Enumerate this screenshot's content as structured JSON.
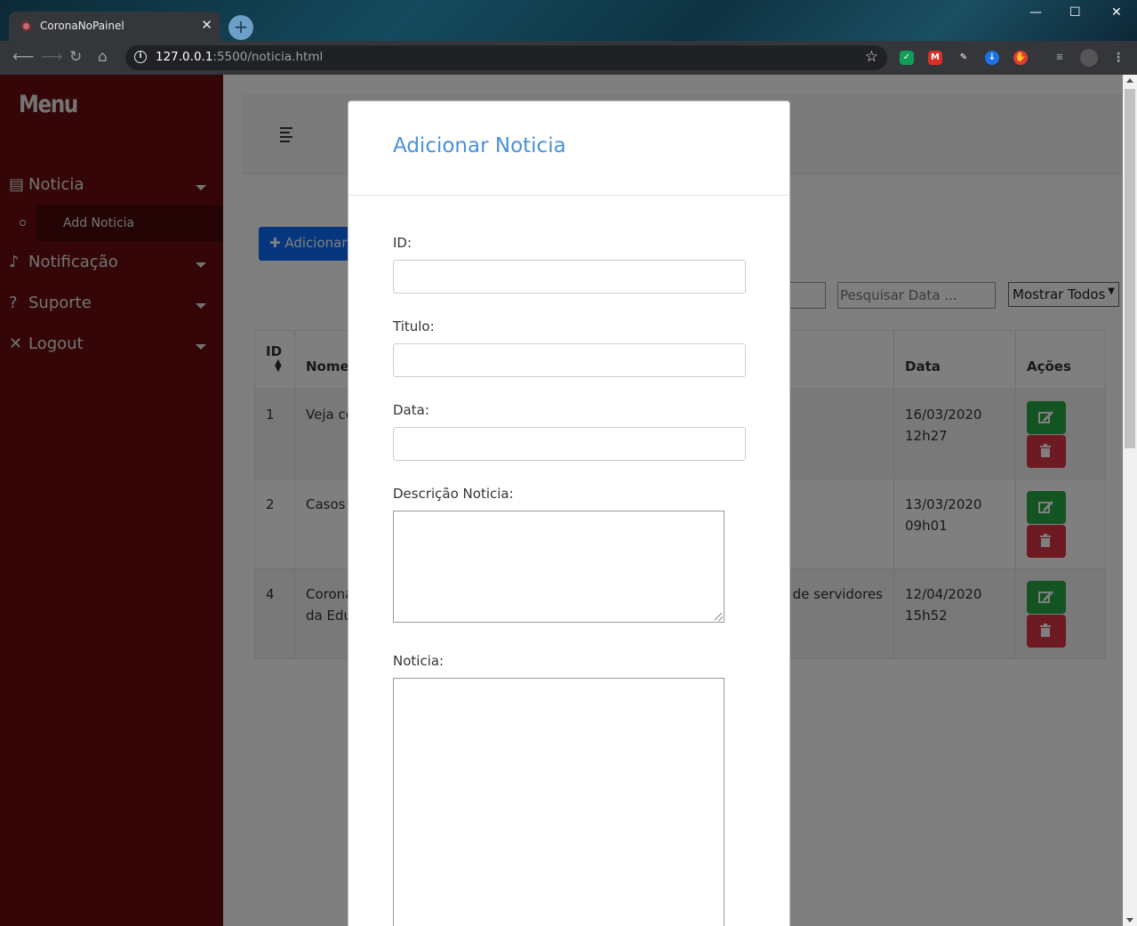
{
  "browser": {
    "tab_title": "CoronaNoPainel",
    "tab_close": "✕",
    "new_tab": "+",
    "url_host": "127.0.0.1",
    "url_path": ":5500/noticia.html",
    "minimize": "—",
    "maximize": "☐",
    "close": "✕"
  },
  "sidebar": {
    "brand": "Menu",
    "items": [
      {
        "label": "Noticia",
        "icon": "newspaper-icon"
      },
      {
        "label": "Notificação",
        "icon": "bell-icon"
      },
      {
        "label": "Suporte",
        "icon": "question-icon"
      },
      {
        "label": "Logout",
        "icon": "times-icon"
      }
    ],
    "submenu_item": "Add Noticia"
  },
  "main": {
    "add_button": "Adicionar",
    "search_date_placeholder": "Pesquisar Data ...",
    "filter_select": "Mostrar Todos",
    "table": {
      "headers": [
        "ID",
        "Nome",
        "Data",
        "Ações"
      ],
      "rows": [
        {
          "id": "1",
          "name": "Veja co",
          "mid": "",
          "date": "16/03/2020",
          "time": "12h27"
        },
        {
          "id": "2",
          "name": "Casos",
          "mid": "",
          "date": "13/03/2020",
          "time": "09h01"
        },
        {
          "id": "4",
          "name": "Corona",
          "name2": "da Edu",
          "mid": "de servidores",
          "date": "12/04/2020",
          "time": "15h52"
        }
      ]
    }
  },
  "modal": {
    "title": "Adicionar Noticia",
    "fields": {
      "id_label": "ID:",
      "titulo_label": "Titulo:",
      "data_label": "Data:",
      "descricao_label": "Descrição Noticia:",
      "noticia_label": "Noticia:"
    }
  },
  "colors": {
    "sidebar": "#6a0c0f",
    "primary": "#0d6efd",
    "modal_title": "#4a90d9",
    "edit": "#28a745",
    "delete": "#dc3545"
  }
}
